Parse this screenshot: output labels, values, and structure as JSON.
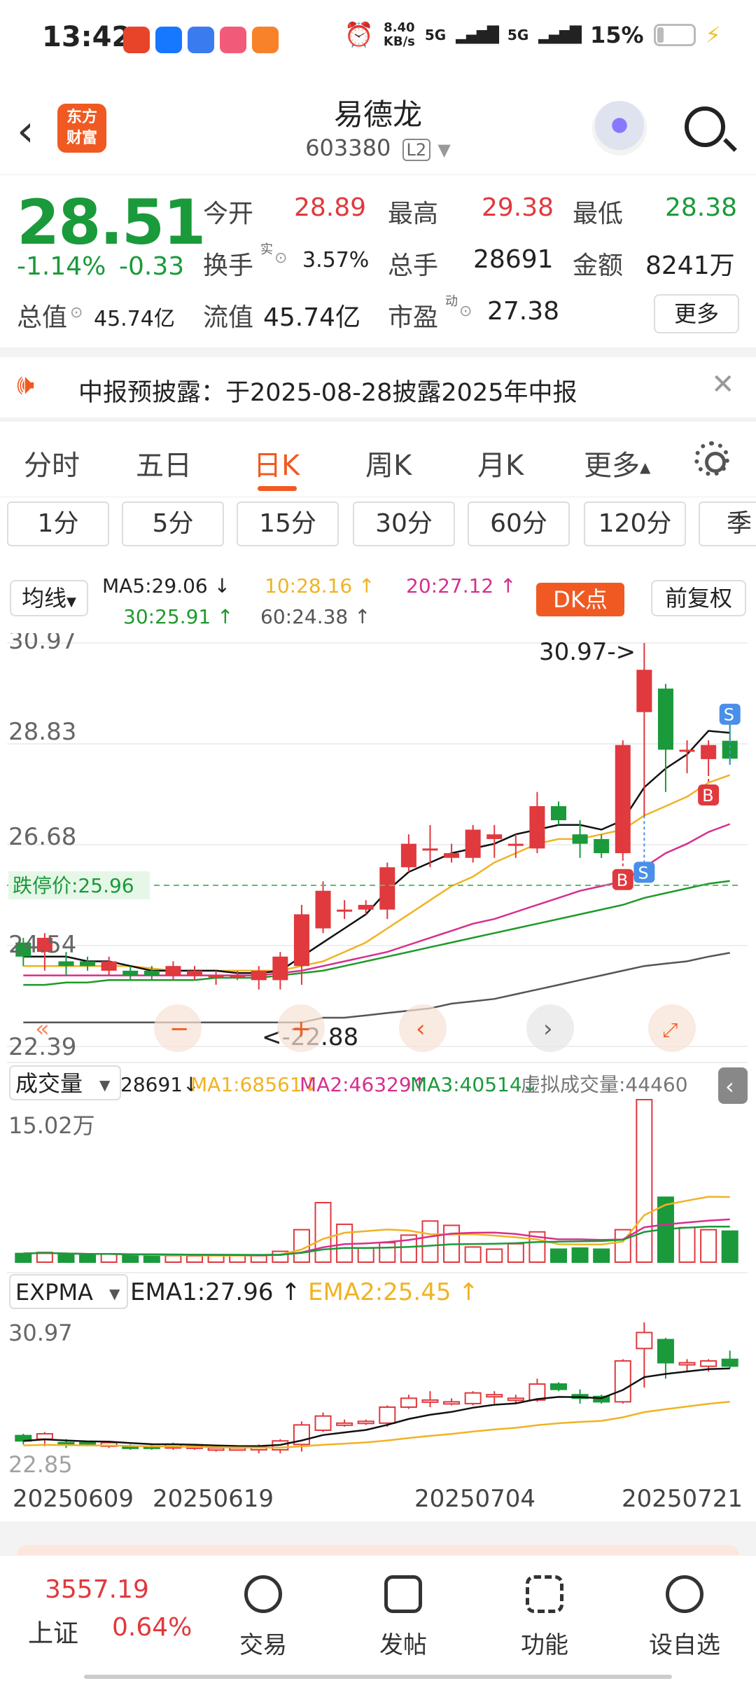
{
  "status_bar": {
    "time": "13:42",
    "net_speed": "8.40",
    "net_unit": "KB/s",
    "signal1": "5G",
    "signal2": "5G",
    "battery": "15%"
  },
  "header": {
    "logo": "东方财富",
    "title": "易德龙",
    "code": "603380",
    "level": "L2"
  },
  "quote": {
    "price": "28.51",
    "change_pct": "-1.14%",
    "change": "-0.33",
    "open_label": "今开",
    "open": "28.89",
    "high_label": "最高",
    "high": "29.38",
    "low_label": "最低",
    "low": "28.38",
    "turnover_label": "换手",
    "turnover_mark": "实",
    "turnover": "3.57%",
    "volume_label": "总手",
    "volume": "28691",
    "amount_label": "金额",
    "amount": "8241万",
    "mktcap_label": "总值",
    "mktcap": "45.74亿",
    "float_label": "流值",
    "float": "45.74亿",
    "pe_label": "市盈",
    "pe_mark": "动",
    "pe": "27.38",
    "more": "更多"
  },
  "notice": {
    "text": "中报预披露：于2025-08-28披露2025年中报"
  },
  "tabs": [
    "分时",
    "五日",
    "日K",
    "周K",
    "月K",
    "更多"
  ],
  "active_tab": "日K",
  "periods": [
    "1分",
    "5分",
    "15分",
    "30分",
    "60分",
    "120分",
    "季"
  ],
  "ma_row": {
    "selector": "均线",
    "ma5": "MA5:29.06 ↓",
    "ma10": "10:28.16 ↑",
    "ma20": "20:27.12 ↑",
    "ma30": "30:25.91 ↑",
    "ma60": "60:24.38 ↑",
    "dk": "DK点",
    "adjust": "前复权"
  },
  "kchart": {
    "y_labels": [
      "30.97",
      "28.83",
      "26.68",
      "24.54",
      "22.39"
    ],
    "limit_down": "跌停价:25.96",
    "high_marker": "30.97->",
    "low_marker": "<-22.88"
  },
  "volume_panel": {
    "selector": "成交量",
    "vol": "28691↓",
    "ma1": "MA1:68561↓",
    "ma2": "MA2:46329↑",
    "ma3": "MA3:40514↓",
    "virtual": "虚拟成交量:44460",
    "max_label": "15.02万"
  },
  "expma_panel": {
    "selector": "EXPMA",
    "ema1": "EMA1:27.96 ↑",
    "ema2": "EMA2:25.45 ↑",
    "top": "30.97",
    "bottom": "22.85"
  },
  "x_dates": [
    "20250609",
    "20250619",
    "20250704",
    "20250721"
  ],
  "colors": {
    "up": "#e0393e",
    "down": "#1a9a3a",
    "accent": "#f05a22",
    "ma5": "#111111",
    "ma10": "#f0b323",
    "ma20": "#d62f8f",
    "ma30": "#1f9a2a",
    "ma60": "#555555"
  },
  "chart_data": {
    "type": "candlestick",
    "ylim": [
      22.39,
      30.97
    ],
    "candles": [
      {
        "o": 24.6,
        "c": 24.3,
        "h": 24.7,
        "l": 24.1
      },
      {
        "o": 24.4,
        "c": 24.7,
        "h": 24.8,
        "l": 24.0
      },
      {
        "o": 24.2,
        "c": 24.1,
        "h": 24.4,
        "l": 23.9
      },
      {
        "o": 24.2,
        "c": 24.1,
        "h": 24.3,
        "l": 24.0
      },
      {
        "o": 24.0,
        "c": 24.2,
        "h": 24.3,
        "l": 23.9
      },
      {
        "o": 24.0,
        "c": 23.9,
        "h": 24.1,
        "l": 23.8
      },
      {
        "o": 24.0,
        "c": 23.9,
        "h": 24.1,
        "l": 23.8
      },
      {
        "o": 23.9,
        "c": 24.1,
        "h": 24.2,
        "l": 23.8
      },
      {
        "o": 23.9,
        "c": 24.0,
        "h": 24.1,
        "l": 23.8
      },
      {
        "o": 23.9,
        "c": 23.9,
        "h": 24.0,
        "l": 23.7
      },
      {
        "o": 23.9,
        "c": 23.9,
        "h": 24.0,
        "l": 23.8
      },
      {
        "o": 23.8,
        "c": 24.0,
        "h": 24.1,
        "l": 23.6
      },
      {
        "o": 23.8,
        "c": 24.3,
        "h": 24.4,
        "l": 23.6
      },
      {
        "o": 24.1,
        "c": 25.2,
        "h": 25.4,
        "l": 23.7
      },
      {
        "o": 24.9,
        "c": 25.7,
        "h": 25.9,
        "l": 24.8
      },
      {
        "o": 25.3,
        "c": 25.3,
        "h": 25.5,
        "l": 25.1
      },
      {
        "o": 25.3,
        "c": 25.4,
        "h": 25.5,
        "l": 25.2
      },
      {
        "o": 25.3,
        "c": 26.2,
        "h": 26.3,
        "l": 25.1
      },
      {
        "o": 26.2,
        "c": 26.7,
        "h": 26.9,
        "l": 26.1
      },
      {
        "o": 26.6,
        "c": 26.6,
        "h": 27.1,
        "l": 26.2
      },
      {
        "o": 26.4,
        "c": 26.5,
        "h": 26.7,
        "l": 26.3
      },
      {
        "o": 26.4,
        "c": 27.0,
        "h": 27.1,
        "l": 26.3
      },
      {
        "o": 26.8,
        "c": 26.9,
        "h": 27.1,
        "l": 26.4
      },
      {
        "o": 26.7,
        "c": 26.7,
        "h": 26.9,
        "l": 26.4
      },
      {
        "o": 26.6,
        "c": 27.5,
        "h": 27.8,
        "l": 26.5
      },
      {
        "o": 27.5,
        "c": 27.2,
        "h": 27.6,
        "l": 27.1
      },
      {
        "o": 26.9,
        "c": 26.7,
        "h": 27.2,
        "l": 26.4
      },
      {
        "o": 26.8,
        "c": 26.5,
        "h": 26.9,
        "l": 26.4
      },
      {
        "o": 26.5,
        "c": 28.8,
        "h": 28.9,
        "l": 26.4
      },
      {
        "o": 29.5,
        "c": 30.4,
        "h": 30.97,
        "l": 27.3
      },
      {
        "o": 30.0,
        "c": 28.7,
        "h": 30.1,
        "l": 27.8
      },
      {
        "o": 28.7,
        "c": 28.7,
        "h": 28.9,
        "l": 28.2
      },
      {
        "o": 28.5,
        "c": 28.8,
        "h": 28.9,
        "l": 28.2
      },
      {
        "o": 28.89,
        "c": 28.51,
        "h": 29.38,
        "l": 28.38
      }
    ],
    "ma5": [
      24.3,
      24.3,
      24.3,
      24.2,
      24.2,
      24.1,
      24.0,
      24.0,
      24.0,
      24.0,
      23.95,
      23.95,
      24.0,
      24.3,
      24.6,
      24.9,
      25.2,
      25.7,
      26.1,
      26.3,
      26.5,
      26.6,
      26.7,
      26.9,
      27.0,
      27.1,
      27.1,
      27.0,
      27.2,
      27.9,
      28.3,
      28.6,
      29.1,
      29.06
    ],
    "ma10": [
      24.1,
      24.1,
      24.1,
      24.1,
      24.1,
      24.1,
      24.05,
      24.0,
      24.0,
      24.0,
      24.0,
      24.0,
      24.0,
      24.1,
      24.2,
      24.4,
      24.6,
      24.9,
      25.2,
      25.5,
      25.8,
      26.0,
      26.3,
      26.5,
      26.7,
      26.8,
      26.8,
      26.9,
      27.0,
      27.3,
      27.5,
      27.7,
      28.0,
      28.16
    ],
    "ma20": [
      23.9,
      23.9,
      23.9,
      23.9,
      23.9,
      23.9,
      23.9,
      23.9,
      23.9,
      23.9,
      23.9,
      23.9,
      23.95,
      24.0,
      24.1,
      24.2,
      24.3,
      24.4,
      24.55,
      24.7,
      24.85,
      25.0,
      25.1,
      25.25,
      25.4,
      25.55,
      25.7,
      25.8,
      25.9,
      26.2,
      26.5,
      26.7,
      26.95,
      27.12
    ],
    "ma30": [
      23.7,
      23.7,
      23.75,
      23.75,
      23.8,
      23.8,
      23.8,
      23.8,
      23.8,
      23.85,
      23.85,
      23.85,
      23.9,
      23.95,
      24.0,
      24.1,
      24.2,
      24.3,
      24.4,
      24.5,
      24.6,
      24.7,
      24.8,
      24.9,
      25.0,
      25.1,
      25.2,
      25.3,
      25.4,
      25.55,
      25.65,
      25.75,
      25.85,
      25.91
    ],
    "ma60": [
      22.9,
      22.9,
      22.9,
      22.9,
      22.9,
      22.9,
      22.9,
      22.9,
      22.9,
      22.9,
      22.9,
      22.9,
      22.9,
      22.9,
      23.0,
      23.0,
      23.05,
      23.1,
      23.15,
      23.2,
      23.3,
      23.35,
      23.4,
      23.5,
      23.6,
      23.7,
      23.8,
      23.9,
      24.0,
      24.1,
      24.15,
      24.2,
      24.3,
      24.38
    ],
    "volume_max": 150200,
    "volume": [
      8000,
      9000,
      7000,
      6500,
      7500,
      6000,
      6200,
      6000,
      5800,
      6000,
      6500,
      6000,
      10000,
      30000,
      55000,
      35000,
      13000,
      18000,
      25000,
      38000,
      34000,
      14000,
      12000,
      17000,
      28000,
      12000,
      13000,
      12000,
      30000,
      150200,
      60000,
      32000,
      30000,
      28691
    ],
    "xlabels": [
      "20250609",
      "20250619",
      "20250704",
      "20250721"
    ]
  },
  "bottom_nav": {
    "index_value": "3557.19",
    "index_name": "上证",
    "index_change": "0.64%",
    "items": [
      "交易",
      "发帖",
      "功能",
      "设自选"
    ]
  }
}
